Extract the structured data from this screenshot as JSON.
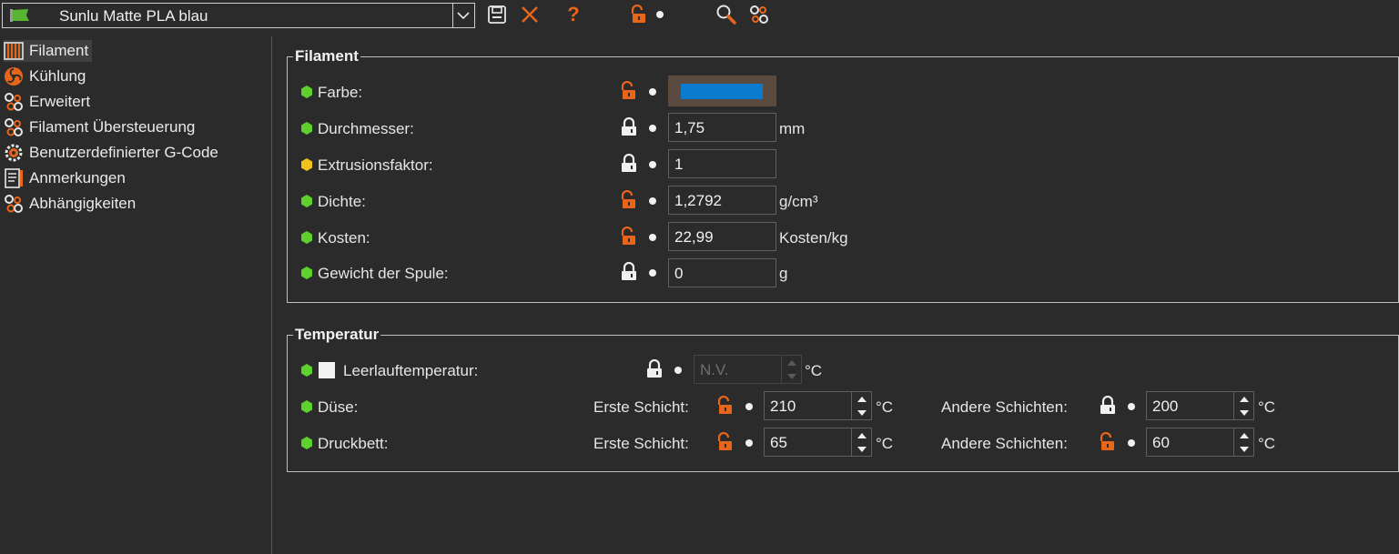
{
  "toolbar": {
    "preset_name": "Sunlu Matte PLA blau",
    "icons": [
      "flag-icon",
      "chevron-down-icon",
      "save-icon",
      "delete-icon",
      "help-icon",
      "unlock-icon",
      "search-icon",
      "compare-icon"
    ]
  },
  "sidebar": {
    "items": [
      {
        "label": "Filament",
        "icon": "filament-spool-icon"
      },
      {
        "label": "Kühlung",
        "icon": "fan-icon"
      },
      {
        "label": "Erweitert",
        "icon": "gears-icon"
      },
      {
        "label": "Filament Übersteuerung",
        "icon": "gears-icon"
      },
      {
        "label": "Benutzerdefinierter G-Code",
        "icon": "gcode-gear-icon"
      },
      {
        "label": "Anmerkungen",
        "icon": "notes-icon"
      },
      {
        "label": "Abhängigkeiten",
        "icon": "gears-icon"
      }
    ]
  },
  "filament_group": {
    "title": "Filament",
    "rows": [
      {
        "label": "Farbe:",
        "value": "",
        "unit": ""
      },
      {
        "label": "Durchmesser:",
        "value": "1,75",
        "unit": "mm"
      },
      {
        "label": "Extrusionsfaktor:",
        "value": "1",
        "unit": ""
      },
      {
        "label": "Dichte:",
        "value": "1,2792",
        "unit": "g/cm³"
      },
      {
        "label": "Kosten:",
        "value": "22,99",
        "unit": "Kosten/kg"
      },
      {
        "label": "Gewicht der Spule:",
        "value": "0",
        "unit": "g"
      }
    ]
  },
  "temperature_group": {
    "title": "Temperatur",
    "idle": {
      "label": "Leerlauftemperatur:",
      "placeholder": "N.V.",
      "unit": "°C"
    },
    "nozzle": {
      "label": "Düse:",
      "first_label": "Erste Schicht:",
      "first_value": "210",
      "first_unit": "°C",
      "other_label": "Andere Schichten:",
      "other_value": "200",
      "other_unit": "°C"
    },
    "bed": {
      "label": "Druckbett:",
      "first_label": "Erste Schicht:",
      "first_value": "65",
      "first_unit": "°C",
      "other_label": "Andere Schichten:",
      "other_value": "60",
      "other_unit": "°C"
    }
  },
  "colors": {
    "accent_orange": "#e8661a",
    "hex_green": "#5fd12e",
    "hex_yellow": "#f3c11b",
    "filament_color": "#0a7bcf"
  }
}
